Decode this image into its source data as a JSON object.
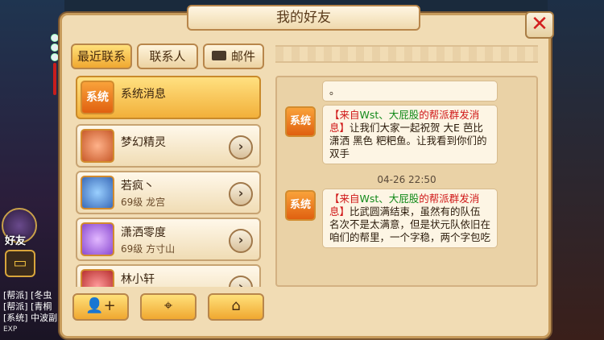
{
  "window": {
    "title": "我的好友",
    "close_icon": "✕"
  },
  "tabs": [
    {
      "label": "最近联系",
      "active": true
    },
    {
      "label": "联系人",
      "active": false
    },
    {
      "label": "邮件",
      "active": false
    }
  ],
  "contacts": [
    {
      "name": "系统消息",
      "sub": "",
      "badge": "系统"
    },
    {
      "name": "梦幻精灵",
      "sub": ""
    },
    {
      "name": "若疯丶",
      "sub": "69级 龙宫"
    },
    {
      "name": "潇洒零度",
      "sub": "69级 方寸山"
    },
    {
      "name": "林小轩",
      "sub": ""
    }
  ],
  "messages": [
    {
      "text": "。"
    },
    {
      "badge": "系统",
      "prefix": "【来自",
      "names": "Wst、大屁股",
      "mid": "的帮派群发消息】",
      "body": "让我们大家一起祝贺 大E 芭比 潇洒 黑色 粑粑鱼。让我看到你们的双手"
    },
    {
      "time": "04-26 22:50"
    },
    {
      "badge": "系统",
      "prefix": "【来自",
      "names": "Wst、大屁股",
      "mid": "的帮派群发消息】",
      "body": "比武圆满结束，虽然有的队伍名次不是太满意，但是状元队依旧在咱们的帮里，一个字稳，两个字包吃"
    }
  ],
  "side": {
    "label": "好友",
    "log": [
      "[帮派] [冬虫",
      "[帮派] [青桐",
      "[系统] 中波副"
    ],
    "exp_label": "EXP"
  },
  "bottom_buttons": [
    "add-user-icon",
    "location-icon",
    "home-icon"
  ]
}
